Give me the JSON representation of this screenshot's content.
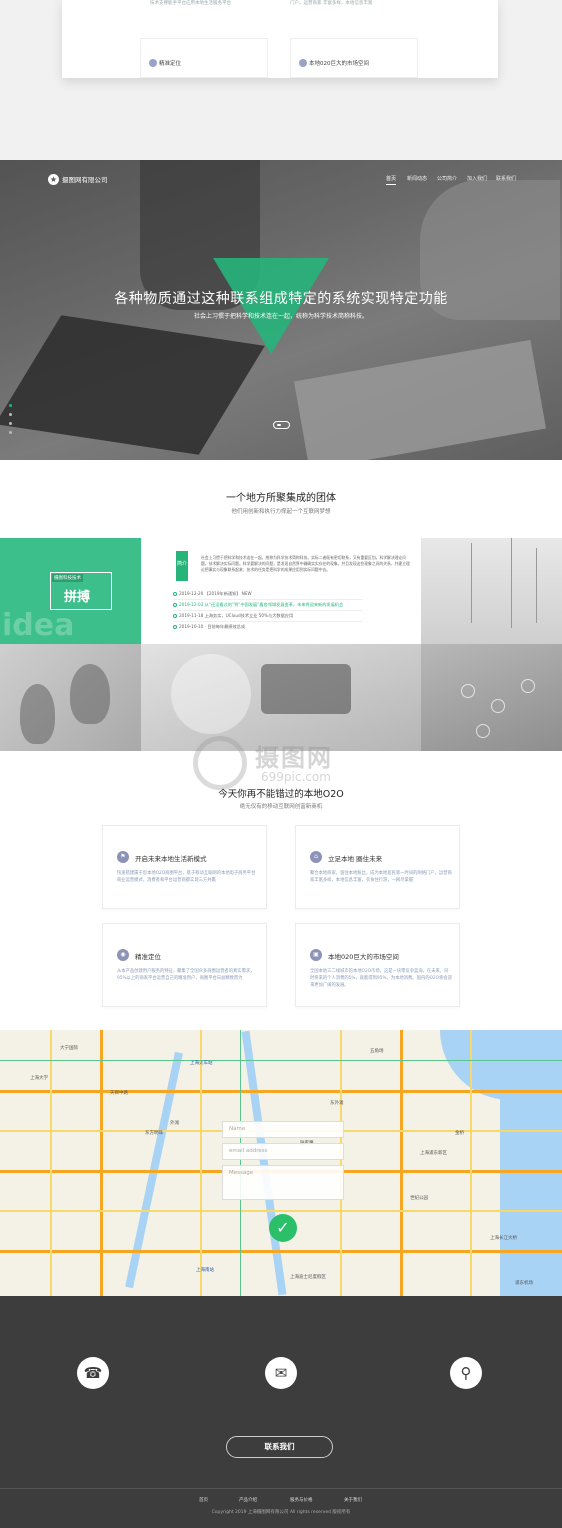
{
  "top_preview": {
    "card_left": {
      "text": "技术支撑能手平台应用本地生活服务平台"
    },
    "card_right_text": "门户，运营商家 丰富多样，本地信息丰富",
    "mini_card_left_title": "精准定位",
    "mini_card_right_title": "本地020巨大的市场空间"
  },
  "nav": {
    "logo_text": "摄图网有限公司",
    "items": [
      "首页",
      "新闻动态",
      "公司简介",
      "加入我们",
      "联系我们"
    ]
  },
  "hero": {
    "title": "各种物质通过这种联系组成特定的系统实现特定功能",
    "subtitle": "社会上习惯于把科学和技术连在一起，统称为科学技术简称科技。"
  },
  "team": {
    "title": "一个地方所聚集成的团体",
    "subtitle": "他们用创新和执行力撑起一个互联网梦想",
    "badge_small": "摄图科技技术",
    "badge_big": "拼搏",
    "idea_word": "idea",
    "label": "简介",
    "desc": "社会上习惯于把科学和技术连在一起，统称为科学技术简称科技。实际二者既有密切联系，又有重要区别。科学解决理论问题，技术解决实际问题。科学要解决的问题，是发现自然界中确确实实存在的现象，并且发现这些现象之间的关系，并建立理论把事实与现象联系起来；技术的任务是把科学的成果应用到实际问题中去。",
    "news": [
      {
        "text": "2019-12-20 【2019年新通知】 NEW",
        "green": false
      },
      {
        "text": "2019-12-03 从“还没看过的”到“中国发展”看各领域发展变革，未来将迎来新的发展机会",
        "green": true
      },
      {
        "text": "2019-11-18 上海务实，UCloud技术立业 50%与大数据应用",
        "green": false
      },
      {
        "text": "2019-10-10 · 目前每年最绩效总成",
        "green": false
      }
    ]
  },
  "watermark": {
    "name": "摄图网",
    "url": "699pic.com"
  },
  "o2o": {
    "title": "今天你再不能错过的本地O2O",
    "subtitle": "绝无仅有的移动互联网创富新商机",
    "cards": [
      {
        "icon": "flag-icon",
        "glyph": "⚑",
        "title": "开启未来本地生活新模式",
        "text": "快速搭建属于您本地O2O商圈平台，基于移动互联网的本地电子商务平台商业运营模式，消费者和平台运营商都实现三方共赢"
      },
      {
        "icon": "home-icon",
        "glyph": "⌂",
        "title": "立足本地 圈住未来",
        "text": "聚合本地商家，留住本地粉丝，成为本地居民第一时间的网络门户，运营商家丰富多样，本地信息丰富，衣食住行游，一网尽掌握"
      },
      {
        "icon": "location-icon",
        "glyph": "◉",
        "title": "精准定位",
        "text": "从本产品创建用户服务的特征，聚集了全国众多商圈运营者的真实需求，95%以上的商家平台运营自己的精准用户，商圈平台日益精致而为"
      },
      {
        "icon": "chart-icon",
        "glyph": "▣",
        "title": "本地020巨大的市场空间",
        "text": "全国本地三二线城市的本地O2O市场，这是一块零竞争蓝海，在未来，同时将来的个人消费的5%，就能得到95%，为本地消费。国内的O2O将会迎来更加广阔的发展。"
      }
    ]
  },
  "map": {
    "labels": [
      "上海南站",
      "上海火车站",
      "上海浦东新区",
      "上海长江大桥",
      "世纪公园",
      "上海大学",
      "外滩",
      "陆家嘴",
      "东方明珠",
      "浦东机场",
      "大宁国际",
      "天目中路",
      "上海迪士尼度假区",
      "东外滩",
      "五角场",
      "金桥"
    ],
    "form": {
      "name_placeholder": "Name",
      "email_placeholder": "email address",
      "message_placeholder": "Message"
    }
  },
  "footer": {
    "contact_button": "联系我们",
    "links": [
      "首页",
      "产品介绍",
      "服务与价格",
      "关于我们"
    ],
    "copyright": "Copyright  2019  上海摄图网有限公司  All rights reserved  版权所有"
  }
}
